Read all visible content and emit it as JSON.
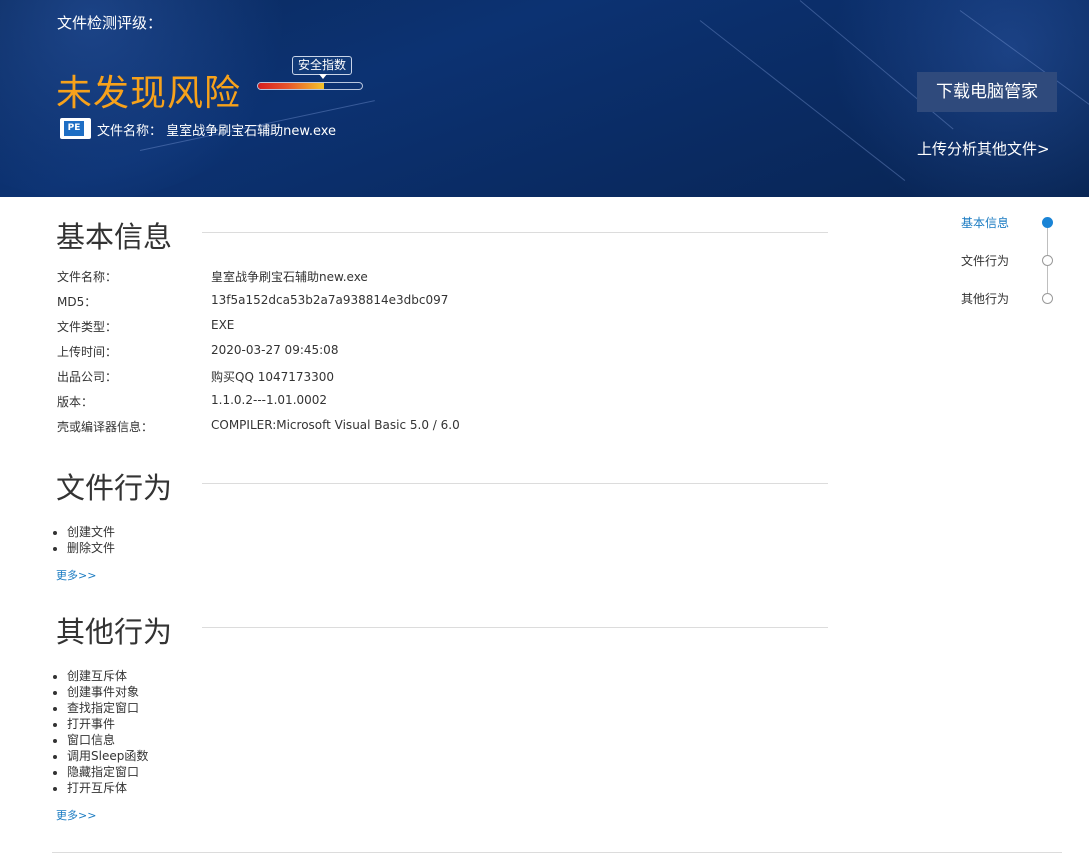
{
  "header": {
    "detect_title": "文件检测评级：",
    "risk_level": "未发现风险",
    "safety_index_label": "安全指数",
    "safety_index_fill": 0.63,
    "file_icon_text": "PE",
    "file_name_label": "文件名称：",
    "file_name": "皇室战争刷宝石辅助new.exe",
    "download_button": "下载电脑管家",
    "upload_link": "上传分析其他文件>"
  },
  "basic_info": {
    "title": "基本信息",
    "rows": [
      {
        "label": "文件名称：",
        "value": "皇室战争刷宝石辅助new.exe"
      },
      {
        "label": "MD5：",
        "value": "13f5a152dca53b2a7a938814e3dbc097"
      },
      {
        "label": "文件类型：",
        "value": "EXE"
      },
      {
        "label": "上传时间：",
        "value": "2020-03-27 09:45:08"
      },
      {
        "label": "出品公司：",
        "value": "购买QQ 1047173300"
      },
      {
        "label": "版本：",
        "value": "1.1.0.2---1.01.0002"
      },
      {
        "label": "壳或编译器信息：",
        "value": "COMPILER:Microsoft Visual Basic 5.0 / 6.0"
      }
    ]
  },
  "file_behavior": {
    "title": "文件行为",
    "items": [
      "创建文件",
      "删除文件"
    ],
    "more": "更多>>"
  },
  "other_behavior": {
    "title": "其他行为",
    "items": [
      "创建互斥体",
      "创建事件对象",
      "查找指定窗口",
      "打开事件",
      "窗口信息",
      "调用Sleep函数",
      "隐藏指定窗口",
      "打开互斥体"
    ],
    "more": "更多>>"
  },
  "side_nav": {
    "items": [
      "基本信息",
      "文件行为",
      "其他行为"
    ],
    "active": "基本信息"
  },
  "colors": {
    "header_bg": "#0c3272",
    "risk_orange": "#f7a21b",
    "link_blue": "#1a7bc2",
    "button_bg": "#2f4a7c"
  }
}
